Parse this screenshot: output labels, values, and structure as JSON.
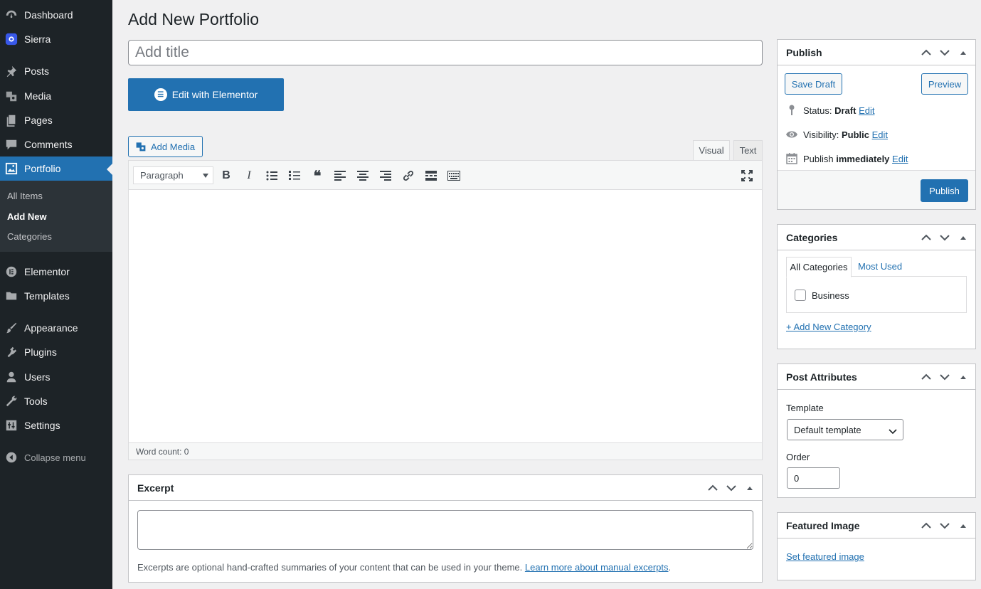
{
  "sidebar": {
    "items": [
      {
        "label": "Dashboard",
        "icon": "dashboard-icon"
      },
      {
        "label": "Sierra",
        "icon": "sierra-icon"
      },
      {
        "label": "Posts",
        "icon": "pin-icon"
      },
      {
        "label": "Media",
        "icon": "media-icon"
      },
      {
        "label": "Pages",
        "icon": "pages-icon"
      },
      {
        "label": "Comments",
        "icon": "comments-icon"
      },
      {
        "label": "Portfolio",
        "icon": "portfolio-icon"
      },
      {
        "label": "Elementor",
        "icon": "elementor-icon"
      },
      {
        "label": "Templates",
        "icon": "folder-icon"
      },
      {
        "label": "Appearance",
        "icon": "brush-icon"
      },
      {
        "label": "Plugins",
        "icon": "plugin-icon"
      },
      {
        "label": "Users",
        "icon": "user-icon"
      },
      {
        "label": "Tools",
        "icon": "wrench-icon"
      },
      {
        "label": "Settings",
        "icon": "settings-icon"
      }
    ],
    "submenu": [
      "All Items",
      "Add New",
      "Categories"
    ],
    "collapse_label": "Collapse menu"
  },
  "main": {
    "page_title": "Add New Portfolio",
    "title_placeholder": "Add title",
    "elementor_button": "Edit with Elementor",
    "add_media": "Add Media",
    "tabs": {
      "visual": "Visual",
      "text": "Text"
    },
    "format_select": "Paragraph",
    "word_count": "Word count: 0"
  },
  "excerpt": {
    "title": "Excerpt",
    "help_text": "Excerpts are optional hand-crafted summaries of your content that can be used in your theme.",
    "help_link": "Learn more about manual excerpts",
    "help_end": "."
  },
  "publish": {
    "title": "Publish",
    "save_draft": "Save Draft",
    "preview": "Preview",
    "status_label": "Status:",
    "status_value": "Draft",
    "visibility_label": "Visibility:",
    "visibility_value": "Public",
    "publish_label": "Publish",
    "publish_value": "immediately",
    "edit": "Edit",
    "publish_button": "Publish"
  },
  "categories": {
    "title": "Categories",
    "tab_all": "All Categories",
    "tab_most_used": "Most Used",
    "items": [
      "Business"
    ],
    "add_new": "+ Add New Category"
  },
  "attributes": {
    "title": "Post Attributes",
    "template_label": "Template",
    "template_value": "Default template",
    "order_label": "Order",
    "order_value": "0"
  },
  "featured": {
    "title": "Featured Image",
    "set_link": "Set featured image"
  },
  "colors": {
    "accent": "#2271b1",
    "sidebar_bg": "#1d2327",
    "page_bg": "#f0f0f1"
  }
}
